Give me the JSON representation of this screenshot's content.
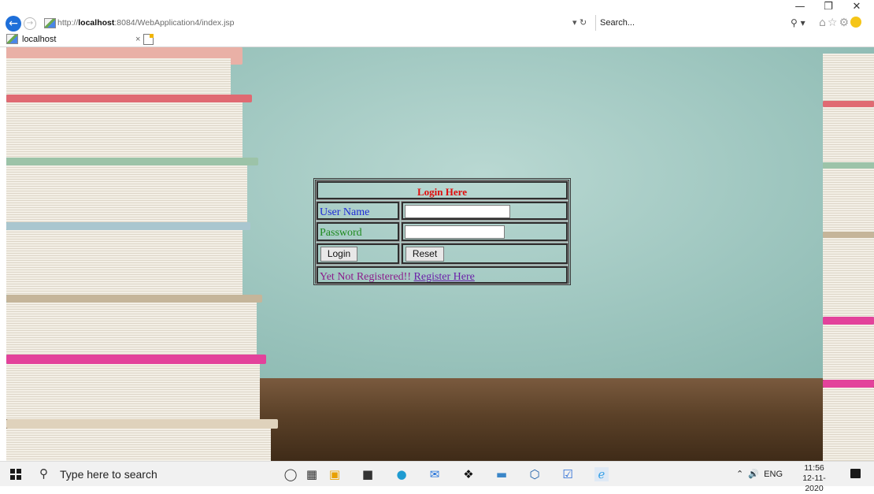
{
  "browser": {
    "url_prefix": "http://",
    "url_host": "localhost",
    "url_rest": ":8084/WebApplication4/index.jsp",
    "search_placeholder": "Search...",
    "tab_title": "localhost",
    "tab_close": "×"
  },
  "login": {
    "title": "Login Here",
    "username_label": "User Name",
    "password_label": "Password",
    "username_value": "",
    "password_value": "",
    "login_button": "Login",
    "reset_button": "Reset",
    "register_prompt": "Yet Not Registered!! ",
    "register_link": "Register Here",
    "colors": {
      "title": "#e10b0b",
      "username_label": "#1f2bd6",
      "password_label": "#1e8a1e",
      "register_text": "#8b1c8b"
    }
  },
  "taskbar": {
    "search_placeholder": "Type here to search",
    "language": "ENG",
    "time": "11:56",
    "date": "12-11-2020"
  }
}
